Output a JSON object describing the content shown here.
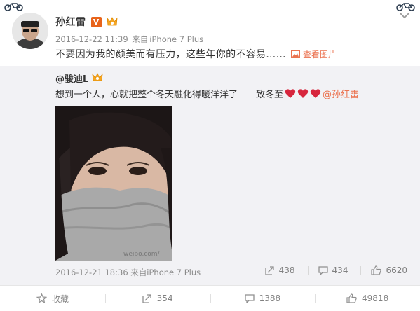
{
  "post": {
    "author": "孙红雷",
    "verified_badge": "V",
    "timestamp": "2016-12-22 11:39",
    "source_prefix": "来自",
    "source": "iPhone 7 Plus",
    "text": "不要因为我的颜美而有压力，这些年你的不容易……",
    "view_pictures": "查看图片"
  },
  "repost": {
    "author": "@骏迪L",
    "text": "想到一个人，心就把整个冬天融化得暖洋洋了——致冬至",
    "mention": "@孙红雷",
    "watermark": "weibo.com/",
    "timestamp": "2016-12-21 18:36",
    "source_prefix": "来自",
    "source": "iPhone 7 Plus",
    "stats": {
      "reposts": "438",
      "comments": "434",
      "likes": "6620"
    }
  },
  "actions": {
    "favorite": "收藏",
    "repost": "354",
    "comment": "1388",
    "like": "49818"
  },
  "colors": {
    "accent": "#eb7350",
    "verified": "#e8641b",
    "heart": "#d7263d",
    "repost_bg": "#f2f2f5"
  },
  "icons": [
    "bike-icon",
    "verified-icon",
    "vip-icon",
    "chevron-down-icon",
    "image-icon",
    "heart-icon",
    "repost-icon",
    "comment-icon",
    "like-icon",
    "star-icon"
  ]
}
